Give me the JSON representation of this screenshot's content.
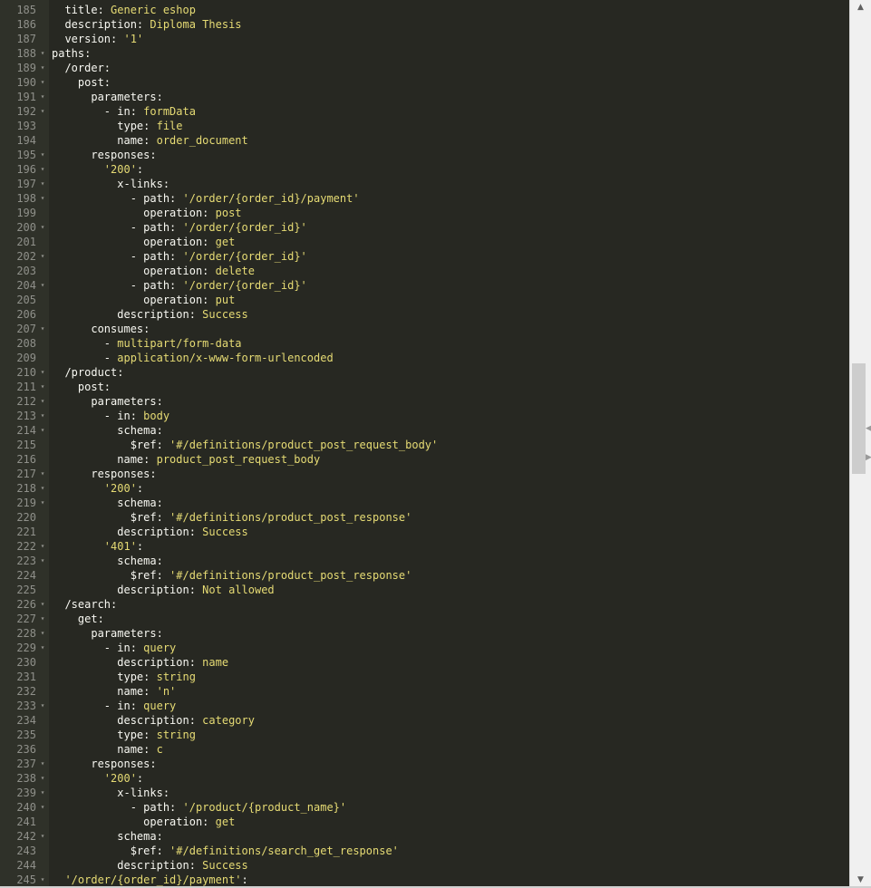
{
  "editor": {
    "lines": [
      {
        "n": "185",
        "fold": false,
        "segs": [
          [
            "k",
            "  title: "
          ],
          [
            "v",
            "Generic eshop"
          ]
        ]
      },
      {
        "n": "186",
        "fold": false,
        "segs": [
          [
            "k",
            "  description: "
          ],
          [
            "v",
            "Diploma Thesis"
          ]
        ]
      },
      {
        "n": "187",
        "fold": false,
        "segs": [
          [
            "k",
            "  version: "
          ],
          [
            "v",
            "'1'"
          ]
        ]
      },
      {
        "n": "188",
        "fold": true,
        "segs": [
          [
            "k",
            "paths:"
          ]
        ]
      },
      {
        "n": "189",
        "fold": true,
        "segs": [
          [
            "k",
            "  /order:"
          ]
        ]
      },
      {
        "n": "190",
        "fold": true,
        "segs": [
          [
            "k",
            "    post:"
          ]
        ]
      },
      {
        "n": "191",
        "fold": true,
        "segs": [
          [
            "k",
            "      parameters:"
          ]
        ]
      },
      {
        "n": "192",
        "fold": true,
        "segs": [
          [
            "d",
            "        - "
          ],
          [
            "k",
            "in: "
          ],
          [
            "v",
            "formData"
          ]
        ]
      },
      {
        "n": "193",
        "fold": false,
        "segs": [
          [
            "k",
            "          type: "
          ],
          [
            "v",
            "file"
          ]
        ]
      },
      {
        "n": "194",
        "fold": false,
        "segs": [
          [
            "k",
            "          name: "
          ],
          [
            "v",
            "order_document"
          ]
        ]
      },
      {
        "n": "195",
        "fold": true,
        "segs": [
          [
            "k",
            "      responses:"
          ]
        ]
      },
      {
        "n": "196",
        "fold": true,
        "segs": [
          [
            "v",
            "        '200'"
          ],
          [
            "k",
            ":"
          ]
        ]
      },
      {
        "n": "197",
        "fold": true,
        "segs": [
          [
            "k",
            "          x-links:"
          ]
        ]
      },
      {
        "n": "198",
        "fold": true,
        "segs": [
          [
            "d",
            "            - "
          ],
          [
            "k",
            "path: "
          ],
          [
            "v",
            "'/order/{order_id}/payment'"
          ]
        ]
      },
      {
        "n": "199",
        "fold": false,
        "segs": [
          [
            "k",
            "              operation: "
          ],
          [
            "v",
            "post"
          ]
        ]
      },
      {
        "n": "200",
        "fold": true,
        "segs": [
          [
            "d",
            "            - "
          ],
          [
            "k",
            "path: "
          ],
          [
            "v",
            "'/order/{order_id}'"
          ]
        ]
      },
      {
        "n": "201",
        "fold": false,
        "segs": [
          [
            "k",
            "              operation: "
          ],
          [
            "v",
            "get"
          ]
        ]
      },
      {
        "n": "202",
        "fold": true,
        "segs": [
          [
            "d",
            "            - "
          ],
          [
            "k",
            "path: "
          ],
          [
            "v",
            "'/order/{order_id}'"
          ]
        ]
      },
      {
        "n": "203",
        "fold": false,
        "segs": [
          [
            "k",
            "              operation: "
          ],
          [
            "v",
            "delete"
          ]
        ]
      },
      {
        "n": "204",
        "fold": true,
        "segs": [
          [
            "d",
            "            - "
          ],
          [
            "k",
            "path: "
          ],
          [
            "v",
            "'/order/{order_id}'"
          ]
        ]
      },
      {
        "n": "205",
        "fold": false,
        "segs": [
          [
            "k",
            "              operation: "
          ],
          [
            "v",
            "put"
          ]
        ]
      },
      {
        "n": "206",
        "fold": false,
        "segs": [
          [
            "k",
            "          description: "
          ],
          [
            "v",
            "Success"
          ]
        ]
      },
      {
        "n": "207",
        "fold": true,
        "segs": [
          [
            "k",
            "      consumes:"
          ]
        ]
      },
      {
        "n": "208",
        "fold": false,
        "segs": [
          [
            "d",
            "        - "
          ],
          [
            "v",
            "multipart/form-data"
          ]
        ]
      },
      {
        "n": "209",
        "fold": false,
        "segs": [
          [
            "d",
            "        - "
          ],
          [
            "v",
            "application/x-www-form-urlencoded"
          ]
        ]
      },
      {
        "n": "210",
        "fold": true,
        "segs": [
          [
            "k",
            "  /product:"
          ]
        ]
      },
      {
        "n": "211",
        "fold": true,
        "segs": [
          [
            "k",
            "    post:"
          ]
        ]
      },
      {
        "n": "212",
        "fold": true,
        "segs": [
          [
            "k",
            "      parameters:"
          ]
        ]
      },
      {
        "n": "213",
        "fold": true,
        "segs": [
          [
            "d",
            "        - "
          ],
          [
            "k",
            "in: "
          ],
          [
            "v",
            "body"
          ]
        ]
      },
      {
        "n": "214",
        "fold": true,
        "segs": [
          [
            "k",
            "          schema:"
          ]
        ]
      },
      {
        "n": "215",
        "fold": false,
        "segs": [
          [
            "k",
            "            $ref: "
          ],
          [
            "v",
            "'#/definitions/product_post_request_body'"
          ]
        ]
      },
      {
        "n": "216",
        "fold": false,
        "segs": [
          [
            "k",
            "          name: "
          ],
          [
            "v",
            "product_post_request_body"
          ]
        ]
      },
      {
        "n": "217",
        "fold": true,
        "segs": [
          [
            "k",
            "      responses:"
          ]
        ]
      },
      {
        "n": "218",
        "fold": true,
        "segs": [
          [
            "v",
            "        '200'"
          ],
          [
            "k",
            ":"
          ]
        ]
      },
      {
        "n": "219",
        "fold": true,
        "segs": [
          [
            "k",
            "          schema:"
          ]
        ]
      },
      {
        "n": "220",
        "fold": false,
        "segs": [
          [
            "k",
            "            $ref: "
          ],
          [
            "v",
            "'#/definitions/product_post_response'"
          ]
        ]
      },
      {
        "n": "221",
        "fold": false,
        "segs": [
          [
            "k",
            "          description: "
          ],
          [
            "v",
            "Success"
          ]
        ]
      },
      {
        "n": "222",
        "fold": true,
        "segs": [
          [
            "v",
            "        '401'"
          ],
          [
            "k",
            ":"
          ]
        ]
      },
      {
        "n": "223",
        "fold": true,
        "segs": [
          [
            "k",
            "          schema:"
          ]
        ]
      },
      {
        "n": "224",
        "fold": false,
        "segs": [
          [
            "k",
            "            $ref: "
          ],
          [
            "v",
            "'#/definitions/product_post_response'"
          ]
        ]
      },
      {
        "n": "225",
        "fold": false,
        "segs": [
          [
            "k",
            "          description: "
          ],
          [
            "v",
            "Not allowed"
          ]
        ]
      },
      {
        "n": "226",
        "fold": true,
        "segs": [
          [
            "k",
            "  /search:"
          ]
        ]
      },
      {
        "n": "227",
        "fold": true,
        "segs": [
          [
            "k",
            "    get:"
          ]
        ]
      },
      {
        "n": "228",
        "fold": true,
        "segs": [
          [
            "k",
            "      parameters:"
          ]
        ]
      },
      {
        "n": "229",
        "fold": true,
        "segs": [
          [
            "d",
            "        - "
          ],
          [
            "k",
            "in: "
          ],
          [
            "v",
            "query"
          ]
        ]
      },
      {
        "n": "230",
        "fold": false,
        "segs": [
          [
            "k",
            "          description: "
          ],
          [
            "v",
            "name"
          ]
        ]
      },
      {
        "n": "231",
        "fold": false,
        "segs": [
          [
            "k",
            "          type: "
          ],
          [
            "v",
            "string"
          ]
        ]
      },
      {
        "n": "232",
        "fold": false,
        "segs": [
          [
            "k",
            "          name: "
          ],
          [
            "v",
            "'n'"
          ]
        ]
      },
      {
        "n": "233",
        "fold": true,
        "segs": [
          [
            "d",
            "        - "
          ],
          [
            "k",
            "in: "
          ],
          [
            "v",
            "query"
          ]
        ]
      },
      {
        "n": "234",
        "fold": false,
        "segs": [
          [
            "k",
            "          description: "
          ],
          [
            "v",
            "category"
          ]
        ]
      },
      {
        "n": "235",
        "fold": false,
        "segs": [
          [
            "k",
            "          type: "
          ],
          [
            "v",
            "string"
          ]
        ]
      },
      {
        "n": "236",
        "fold": false,
        "segs": [
          [
            "k",
            "          name: "
          ],
          [
            "v",
            "c"
          ]
        ]
      },
      {
        "n": "237",
        "fold": true,
        "segs": [
          [
            "k",
            "      responses:"
          ]
        ]
      },
      {
        "n": "238",
        "fold": true,
        "segs": [
          [
            "v",
            "        '200'"
          ],
          [
            "k",
            ":"
          ]
        ]
      },
      {
        "n": "239",
        "fold": true,
        "segs": [
          [
            "k",
            "          x-links:"
          ]
        ]
      },
      {
        "n": "240",
        "fold": true,
        "segs": [
          [
            "d",
            "            - "
          ],
          [
            "k",
            "path: "
          ],
          [
            "v",
            "'/product/{product_name}'"
          ]
        ]
      },
      {
        "n": "241",
        "fold": false,
        "segs": [
          [
            "k",
            "              operation: "
          ],
          [
            "v",
            "get"
          ]
        ]
      },
      {
        "n": "242",
        "fold": true,
        "segs": [
          [
            "k",
            "          schema:"
          ]
        ]
      },
      {
        "n": "243",
        "fold": false,
        "segs": [
          [
            "k",
            "            $ref: "
          ],
          [
            "v",
            "'#/definitions/search_get_response'"
          ]
        ]
      },
      {
        "n": "244",
        "fold": false,
        "segs": [
          [
            "k",
            "          description: "
          ],
          [
            "v",
            "Success"
          ]
        ]
      },
      {
        "n": "245",
        "fold": true,
        "segs": [
          [
            "v",
            "  '/order/{order_id}/payment'"
          ],
          [
            "k",
            ":"
          ]
        ]
      }
    ]
  },
  "icons": {
    "fold": "chevron-down-icon",
    "scroll_up": "triangle-up-icon",
    "scroll_down": "triangle-down-icon"
  },
  "glyphs": {
    "fold": "▾",
    "scroll_up": "▲",
    "scroll_down": "▼",
    "splitter_left": "◀",
    "splitter_right": "▶"
  },
  "colors": {
    "background": "#272822",
    "gutter": "#2f3129",
    "line_number": "#8f908a",
    "key": "#f8f8f2",
    "string": "#e6db74",
    "scrollbar_track": "#f0f0f0",
    "scrollbar_thumb": "#cdcdcd"
  },
  "scroll": {
    "position_fraction": 0.41,
    "visible_fraction": 0.13
  }
}
